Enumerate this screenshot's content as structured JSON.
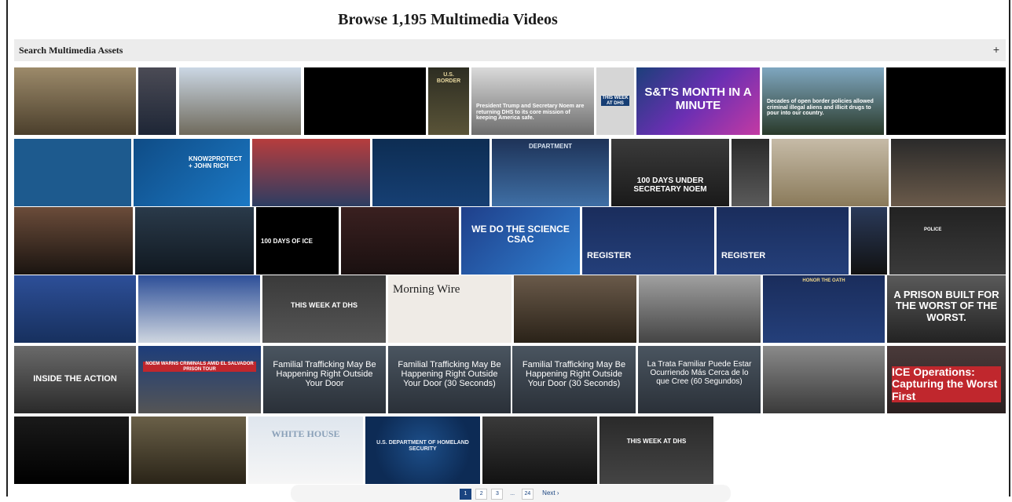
{
  "page": {
    "title": "Browse 1,195 Multimedia Videos"
  },
  "search": {
    "label": "Search Multimedia Assets",
    "toggle": "+"
  },
  "videos": [
    {
      "caption": ""
    },
    {
      "caption": ""
    },
    {
      "caption": ""
    },
    {
      "caption": ""
    },
    {
      "caption": "U.S. BORDER"
    },
    {
      "caption": "President Trump and Secretary Noem are returning DHS to its core mission of keeping America safe."
    },
    {
      "caption": "THIS WEEK AT DHS"
    },
    {
      "caption": "S&T'S MONTH IN A MINUTE"
    },
    {
      "caption": "Decades of open border policies allowed criminal illegal aliens and illicit drugs to pour into our country."
    },
    {
      "caption": ""
    },
    {
      "caption": ""
    },
    {
      "caption": "KNOW2PROTECT + JOHN RICH"
    },
    {
      "caption": ""
    },
    {
      "caption": ""
    },
    {
      "caption": "DEPARTMENT"
    },
    {
      "caption": "100 DAYS UNDER SECRETARY NOEM"
    },
    {
      "caption": ""
    },
    {
      "caption": ""
    },
    {
      "caption": ""
    },
    {
      "caption": ""
    },
    {
      "caption": ""
    },
    {
      "caption": "100 DAYS OF ICE"
    },
    {
      "caption": ""
    },
    {
      "caption": "WE DO THE SCIENCE CSAC"
    },
    {
      "caption": "REGISTER"
    },
    {
      "caption": "REGISTER"
    },
    {
      "caption": ""
    },
    {
      "caption": "POLICE"
    },
    {
      "caption": ""
    },
    {
      "caption": ""
    },
    {
      "caption": "THIS WEEK AT DHS"
    },
    {
      "caption": "Morning Wire"
    },
    {
      "caption": ""
    },
    {
      "caption": ""
    },
    {
      "caption": "HONOR THE OATH"
    },
    {
      "caption": "A PRISON BUILT FOR THE WORST OF THE WORST."
    },
    {
      "caption": "INSIDE THE ACTION"
    },
    {
      "caption": "NOEM WARNS CRIMINALS AMID EL SALVADOR PRISON TOUR"
    },
    {
      "caption": "Familial Trafficking May Be Happening Right Outside Your Door"
    },
    {
      "caption": "Familial Trafficking May Be Happening Right Outside Your Door (30 Seconds)"
    },
    {
      "caption": "Familial Trafficking May Be Happening Right Outside Your Door (30 Seconds)"
    },
    {
      "caption": "La Trata Familiar Puede Estar Ocurriendo Más Cerca de lo que Cree (60 Segundos)"
    },
    {
      "caption": ""
    },
    {
      "caption": "ICE Operations: Capturing the Worst First"
    },
    {
      "caption": ""
    },
    {
      "caption": ""
    },
    {
      "caption": "WHITE HOUSE"
    },
    {
      "caption": "U.S. DEPARTMENT OF HOMELAND SECURITY"
    },
    {
      "caption": ""
    },
    {
      "caption": "THIS WEEK AT DHS"
    }
  ],
  "pagination": {
    "pages": [
      "1",
      "2",
      "3",
      "...",
      "24"
    ],
    "next": "Next ›",
    "current": "1"
  },
  "colors": {
    "accent": "#1a4480",
    "search_bg": "#ececec"
  }
}
